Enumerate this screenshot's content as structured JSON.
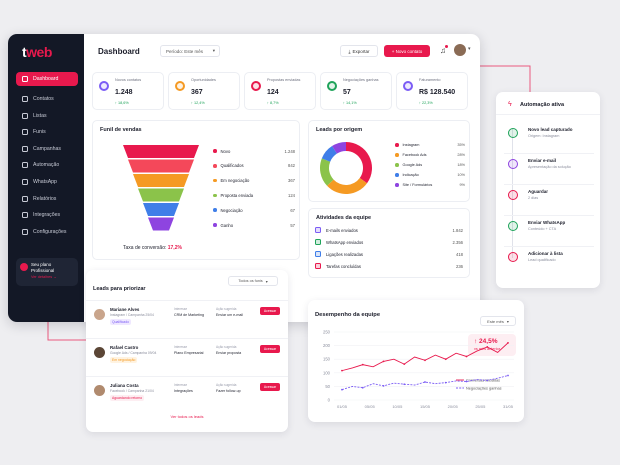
{
  "logo": {
    "t": "t",
    "w": "web"
  },
  "sidebar": {
    "items": [
      "Dashboard",
      "Contatos",
      "Listas",
      "Funis",
      "Campanhas",
      "Automação",
      "WhatsApp",
      "Relatórios",
      "Integrações",
      "Configurações"
    ],
    "plan_title": "Seu plano Profissional",
    "plan_link": "Ver detalhes →"
  },
  "header": {
    "title": "Dashboard",
    "period": "Período: Este mês",
    "export": "Exportar",
    "new_contact": "+ Novo contato"
  },
  "kpis": [
    {
      "label": "Novos contatos",
      "value": "1.248",
      "delta": "↑ 18,6%",
      "color": "#7b5cf5"
    },
    {
      "label": "Oportunidades",
      "value": "367",
      "delta": "↑ 12,4%",
      "color": "#f59a23"
    },
    {
      "label": "Propostas enviadas",
      "value": "124",
      "delta": "↑ 8,7%",
      "color": "#e8194d"
    },
    {
      "label": "Negociações ganhas",
      "value": "57",
      "delta": "↑ 14,1%",
      "color": "#1fa35a"
    },
    {
      "label": "Faturamento",
      "value": "R$ 128.540",
      "delta": "↑ 22,3%",
      "color": "#7b5cf5"
    }
  ],
  "funnel": {
    "title": "Funil de vendas",
    "conv_label": "Taxa de conversão:",
    "conv_value": "17,2%",
    "stages": [
      {
        "name": "Novo",
        "value": "1.248",
        "color": "#e8194d"
      },
      {
        "name": "Qualificados",
        "value": "842",
        "color": "#f4485a"
      },
      {
        "name": "Em negociação",
        "value": "367",
        "color": "#f59a23"
      },
      {
        "name": "Proposta enviada",
        "value": "124",
        "color": "#8bc34a"
      },
      {
        "name": "Negociação",
        "value": "67",
        "color": "#3f7ee8"
      },
      {
        "name": "Ganho",
        "value": "57",
        "color": "#8e44e0"
      }
    ]
  },
  "origin": {
    "title": "Leads por origem",
    "items": [
      {
        "name": "Instagram",
        "value": "35%",
        "color": "#e8194d"
      },
      {
        "name": "Facebook Ads",
        "value": "28%",
        "color": "#f59a23"
      },
      {
        "name": "Google Ads",
        "value": "18%",
        "color": "#8bc34a"
      },
      {
        "name": "Indicação",
        "value": "10%",
        "color": "#3f7ee8"
      },
      {
        "name": "Site / Formulários",
        "value": "9%",
        "color": "#8e44e0"
      }
    ]
  },
  "activities": {
    "title": "Atividades da equipe",
    "items": [
      {
        "name": "E-mails enviados",
        "value": "1.842"
      },
      {
        "name": "WhatsApp enviados",
        "value": "2.356"
      },
      {
        "name": "Ligações realizadas",
        "value": "418"
      },
      {
        "name": "Tarefas concluídas",
        "value": "236"
      }
    ]
  },
  "leads": {
    "title": "Leads para priorizar",
    "filter": "Todos os funis",
    "view_all": "Ver todos os leads",
    "action_label": "Acessar",
    "rows": [
      {
        "name": "Mariane Alves",
        "source": "Instagram / Campanha 25/04",
        "tag": "Qualificado",
        "stage_l": "Interesse",
        "stage": "CRM de Marketing",
        "next_l": "Ação sugerida",
        "next": "Enviar um e-mail"
      },
      {
        "name": "Rafael Castro",
        "source": "Google Ads / Campanha 09/04",
        "tag": "Em negociação",
        "stage_l": "Interesse",
        "stage": "Plano Empresarial",
        "next_l": "Ação sugerida",
        "next": "Enviar proposta"
      },
      {
        "name": "Juliana Costa",
        "source": "Facebook / Campanha 21/04",
        "tag": "Aguardando retorno",
        "stage_l": "Interesse",
        "stage": "Integrações",
        "next_l": "Ação sugerida",
        "next": "Fazer follow-up"
      }
    ]
  },
  "automation": {
    "title": "Automação ativa",
    "steps": [
      {
        "title": "Novo lead capturado",
        "sub": "Origem: Instagram",
        "color": "#1fa35a"
      },
      {
        "title": "Enviar e-mail",
        "sub": "Apresentação da solução",
        "color": "#8e44e0"
      },
      {
        "title": "Aguardar",
        "sub": "2 dias",
        "color": "#e8194d"
      },
      {
        "title": "Enviar WhatsApp",
        "sub": "Conteúdo + CTA",
        "color": "#1fa35a"
      },
      {
        "title": "Adicionar à lista",
        "sub": "Lead qualificado",
        "color": "#e8194d"
      }
    ]
  },
  "performance": {
    "title": "Desempenho da equipe",
    "period": "Este mês",
    "delta": "↑ 24,5%",
    "delta_sub": "vs mês anterior",
    "chart_data": {
      "type": "line",
      "x": [
        "01/05",
        "05/05",
        "10/05",
        "15/05",
        "20/05",
        "25/05",
        "31/05"
      ],
      "ylim": [
        0,
        250
      ],
      "yticks": [
        0,
        50,
        100,
        150,
        200,
        250
      ],
      "series": [
        {
          "name": "Conversas iniciadas",
          "color": "#e8194d",
          "values": [
            108,
            118,
            130,
            122,
            142,
            150,
            132,
            158,
            146,
            165,
            150,
            172,
            160,
            180,
            195,
            175,
            210
          ]
        },
        {
          "name": "Negociações ganhas",
          "color": "#7b5cf5",
          "values": [
            38,
            50,
            45,
            60,
            52,
            62,
            58,
            55,
            66,
            60,
            64,
            70,
            68,
            75,
            72,
            80,
            90
          ]
        }
      ]
    }
  }
}
